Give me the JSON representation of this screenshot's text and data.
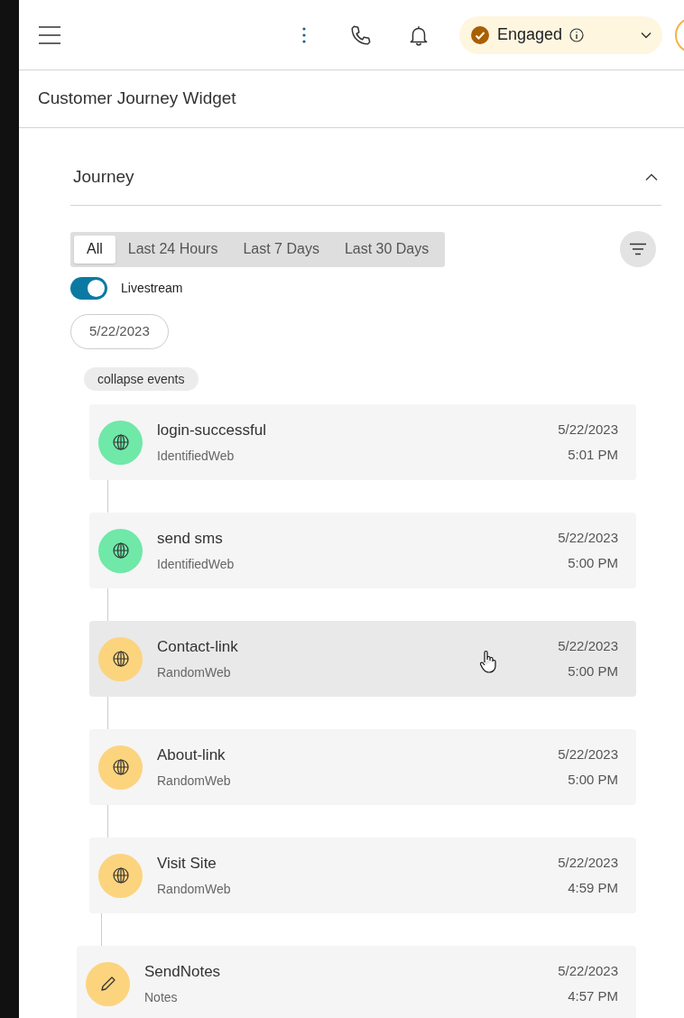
{
  "status": {
    "label": "Engaged"
  },
  "widget_title": "Customer Journey Widget",
  "section": {
    "title": "Journey",
    "expanded": true
  },
  "tabs": [
    {
      "label": "All",
      "selected": true
    },
    {
      "label": "Last 24 Hours",
      "selected": false
    },
    {
      "label": "Last 7 Days",
      "selected": false
    },
    {
      "label": "Last 30 Days",
      "selected": false
    }
  ],
  "livestream": {
    "label": "Livestream",
    "on": true
  },
  "date_chip": "5/22/2023",
  "collapse_button": "collapse events",
  "events": [
    {
      "kind": "web",
      "color": "#6fe8a8",
      "title": "login-successful",
      "source": "IdentifiedWeb",
      "date": "5/22/2023",
      "time": "5:01 PM",
      "highlighted": false
    },
    {
      "kind": "web",
      "color": "#6fe8a8",
      "title": "send sms",
      "source": "IdentifiedWeb",
      "date": "5/22/2023",
      "time": "5:00 PM",
      "highlighted": false
    },
    {
      "kind": "web",
      "color": "#fcd47e",
      "title": "Contact-link",
      "source": "RandomWeb",
      "date": "5/22/2023",
      "time": "5:00 PM",
      "highlighted": true
    },
    {
      "kind": "web",
      "color": "#fcd47e",
      "title": "About-link",
      "source": "RandomWeb",
      "date": "5/22/2023",
      "time": "5:00 PM",
      "highlighted": false
    },
    {
      "kind": "web",
      "color": "#fcd47e",
      "title": "Visit Site",
      "source": "RandomWeb",
      "date": "5/22/2023",
      "time": "4:59 PM",
      "highlighted": false
    },
    {
      "kind": "notes",
      "color": "#fcd47e",
      "title": "SendNotes",
      "source": "Notes",
      "date": "5/22/2023",
      "time": "4:57 PM",
      "highlighted": false
    }
  ]
}
